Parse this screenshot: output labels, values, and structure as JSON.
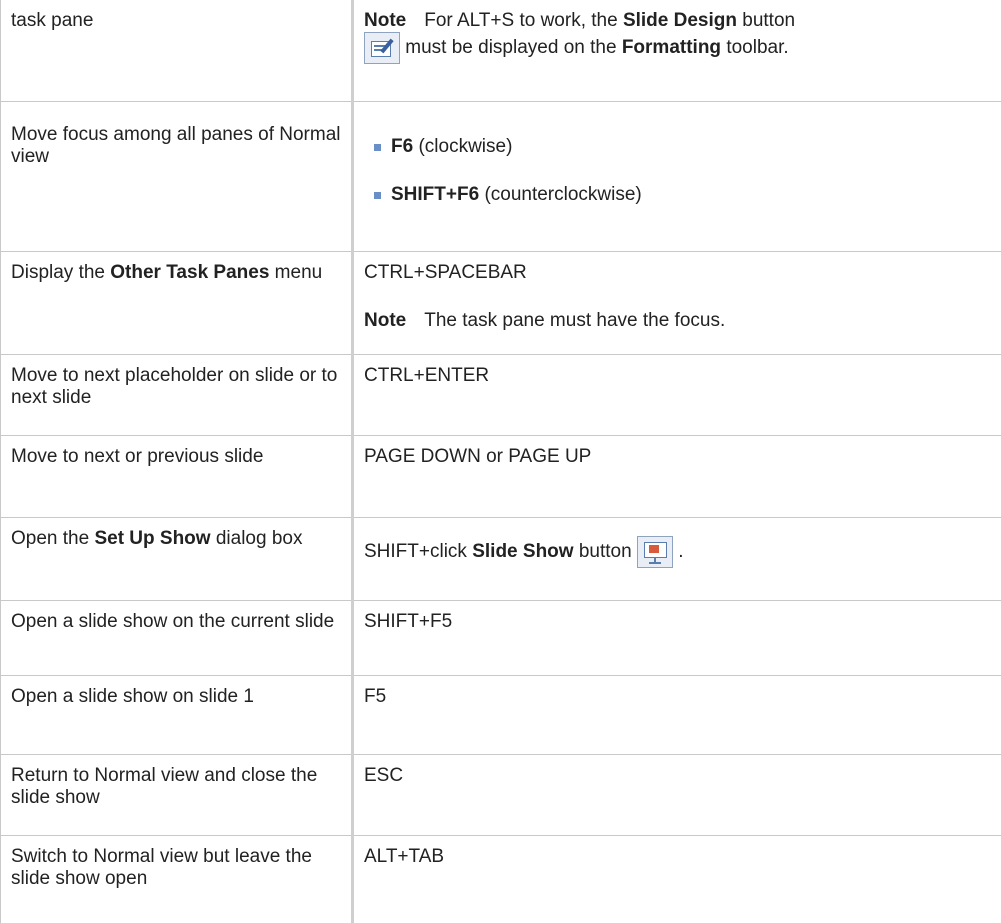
{
  "rows": [
    {
      "action": [
        "task pane"
      ],
      "note_label": "Note",
      "note_text_1": "For ALT+S to work, the",
      "note_bold_1": "Slide Design",
      "note_text_2": "button",
      "note_text_3": "must be displayed on the",
      "note_bold_2": "Formatting",
      "note_text_4": "toolbar.",
      "icon": "slide-design-icon"
    },
    {
      "action_text": "Move focus among all panes of Normal view",
      "bullets": [
        {
          "key": "F6",
          "desc": "(clockwise)"
        },
        {
          "key": "SHIFT+F6",
          "desc": "(counterclockwise)"
        }
      ]
    },
    {
      "action_pre": "Display the",
      "action_bold": "Other Task Panes",
      "action_post": "menu",
      "shortcut": "CTRL+SPACEBAR",
      "note_label": "Note",
      "note_text": "The task pane must have the focus."
    },
    {
      "action_text": "Move to next placeholder on slide or to next slide",
      "shortcut": "CTRL+ENTER"
    },
    {
      "action_text": "Move to next or previous slide",
      "shortcut": "PAGE DOWN or PAGE UP"
    },
    {
      "action_pre": "Open the",
      "action_bold": "Set Up Show",
      "action_post": "dialog box",
      "shortcut_pre": "SHIFT+click",
      "shortcut_bold": "Slide Show",
      "shortcut_post": "button",
      "shortcut_end": ".",
      "icon": "slide-show-icon"
    },
    {
      "action_text": "Open a slide show on the current slide",
      "shortcut": "SHIFT+F5"
    },
    {
      "action_text": "Open a slide show on slide 1",
      "shortcut": "F5"
    },
    {
      "action_text": "Return to Normal view and close the slide show",
      "shortcut": "ESC"
    },
    {
      "action_text": "Switch to Normal view but leave the slide show open",
      "shortcut": "ALT+TAB"
    }
  ]
}
